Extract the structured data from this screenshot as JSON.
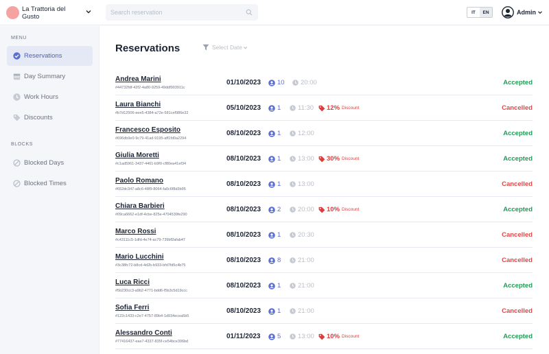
{
  "brand": {
    "name": "La Trattoria del Gusto"
  },
  "search": {
    "placeholder": "Search reservation"
  },
  "languages": [
    "IT",
    "EN"
  ],
  "active_language": "EN",
  "user": {
    "name": "Admin"
  },
  "sidebar": {
    "menu_title": "MENU",
    "menu_items": [
      {
        "label": "Reservations",
        "icon": "check-circle-icon",
        "active": true
      },
      {
        "label": "Day Summary",
        "icon": "calendar-icon",
        "active": false
      },
      {
        "label": "Work Hours",
        "icon": "clock-icon",
        "active": false
      },
      {
        "label": "Discounts",
        "icon": "tag-icon",
        "active": false
      }
    ],
    "blocks_title": "BLOCKS",
    "blocks_items": [
      {
        "label": "Blocked Days",
        "icon": "blocked-icon"
      },
      {
        "label": "Blocked Times",
        "icon": "blocked-icon"
      }
    ]
  },
  "main": {
    "title": "Reservations",
    "filter_label": "Select Date",
    "discount_word": "Discount",
    "reservations": [
      {
        "name": "Andrea Marini",
        "id": "#44732fdf-42f2-4a80-9259-49ddf903911c",
        "date": "01/10/2023",
        "guests": "10",
        "time": "20:00",
        "discount": "",
        "status": "Accepted"
      },
      {
        "name": "Laura Bianchi",
        "id": "#b7d12506-eee5-4384-a72e-581cef986e32",
        "date": "05/10/2023",
        "guests": "1",
        "time": "11:30",
        "discount": "12%",
        "status": "Cancelled"
      },
      {
        "name": "Francesco Esposito",
        "id": "#696db9e0-9c79-41ad-9195-aff1fd0a2294",
        "date": "08/10/2023",
        "guests": "1",
        "time": "12:00",
        "discount": "",
        "status": "Accepted"
      },
      {
        "name": "Giulia Moretti",
        "id": "#c1ad5961-3437-4461-b9f0-cf80ea41ef34",
        "date": "08/10/2023",
        "guests": "1",
        "time": "13:00",
        "discount": "30%",
        "status": "Accepted"
      },
      {
        "name": "Paolo Romano",
        "id": "#652dc347-a8c6-48f9-8064-fa0c6f8d3b95",
        "date": "08/10/2023",
        "guests": "1",
        "time": "13:00",
        "discount": "",
        "status": "Cancelled"
      },
      {
        "name": "Chiara Barbieri",
        "id": "#09ca6662-e1df-4cbe-825e-4704539fe290",
        "date": "08/10/2023",
        "guests": "2",
        "time": "20:00",
        "discount": "10%",
        "status": "Accepted"
      },
      {
        "name": "Marco Rossi",
        "id": "#c43111c5-1dfd-4e74-ac79-739bf2afab47",
        "date": "08/10/2023",
        "guests": "1",
        "time": "20:30",
        "discount": "",
        "status": "Cancelled"
      },
      {
        "name": "Mario Lucchini",
        "id": "#3c38fc72-b8cd-4d2b-b933-bfd7fd5c4b75",
        "date": "08/10/2023",
        "guests": "8",
        "time": "21:00",
        "discount": "",
        "status": "Cancelled"
      },
      {
        "name": "Luca Ricci",
        "id": "#5b230cc3-a9b2-4771-bdd6-f5b3c5d19ccc",
        "date": "08/10/2023",
        "guests": "1",
        "time": "21:00",
        "discount": "",
        "status": "Accepted"
      },
      {
        "name": "Sofia Ferri",
        "id": "#122c1433-c2e7-4757-89b4-1d934ecea5b5",
        "date": "08/10/2023",
        "guests": "1",
        "time": "21:00",
        "discount": "",
        "status": "Cancelled"
      },
      {
        "name": "Alessandro Conti",
        "id": "#77416437-eae7-4337-835f-ce54bce306bd",
        "date": "01/11/2023",
        "guests": "5",
        "time": "13:00",
        "discount": "10%",
        "status": "Accepted"
      }
    ]
  },
  "colors": {
    "accent": "#5b6fd0",
    "accepted": "#1f9d55",
    "cancelled": "#e04848",
    "brand_logo": "#f7a2a2"
  }
}
